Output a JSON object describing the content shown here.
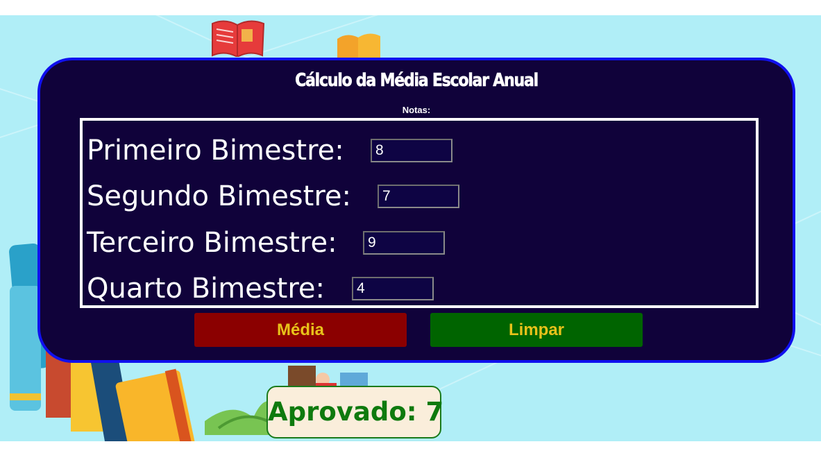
{
  "app": {
    "title": "Cálculo da Média Escolar Anual",
    "notas_label": "Notas:"
  },
  "fields": [
    {
      "label": "Primeiro Bimestre:",
      "value": "8"
    },
    {
      "label": "Segundo Bimestre:",
      "value": "7"
    },
    {
      "label": "Terceiro Bimestre:",
      "value": "9"
    },
    {
      "label": "Quarto Bimestre:",
      "value": "4"
    }
  ],
  "buttons": {
    "media_label": "Média",
    "limpar_label": "Limpar"
  },
  "result": {
    "text": "Aprovado: 7"
  },
  "colors": {
    "background": "#b0eef7",
    "panel": "#10023a",
    "panel_border": "#1010ee",
    "media_button": "#8b0000",
    "limpar_button": "#006400",
    "button_text": "#e8c21a",
    "result_text": "#0e7a0e",
    "result_background": "#faeedb"
  },
  "icons": [
    "book-illustration",
    "reading-boy-illustration",
    "grass-illustration"
  ]
}
